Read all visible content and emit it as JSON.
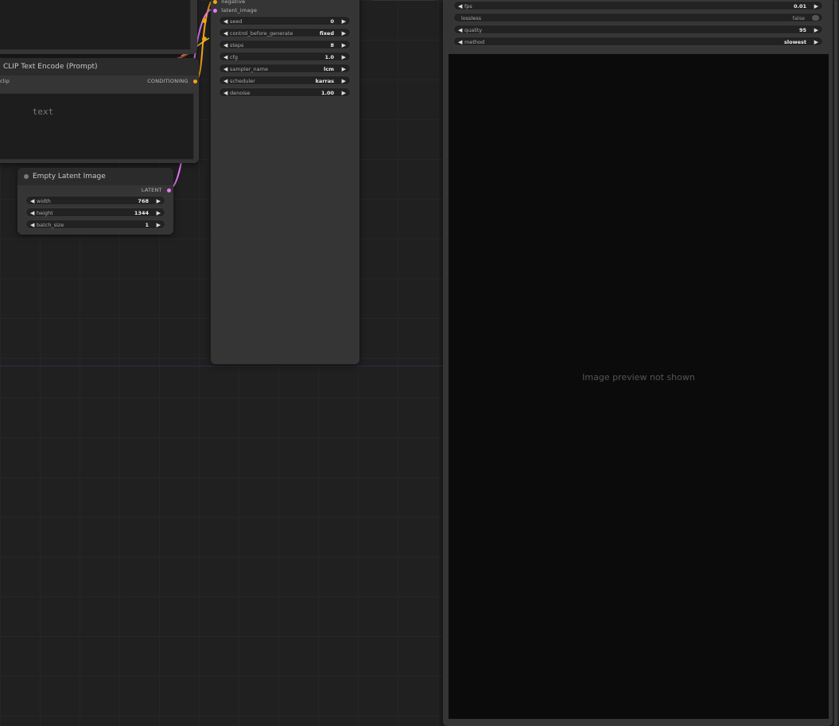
{
  "positive_prompt": {
    "text": ""
  },
  "negative_prompt_node": {
    "title": "CLIP Text Encode (Prompt)",
    "input_clip": "clip",
    "output": "CONDITIONING",
    "placeholder": "text"
  },
  "ksampler": {
    "inputs": [
      "negative",
      "latent_image"
    ],
    "widgets": [
      {
        "label": "seed",
        "value": "0"
      },
      {
        "label": "control_before_generate",
        "value": "fixed"
      },
      {
        "label": "steps",
        "value": "8"
      },
      {
        "label": "cfg",
        "value": "1.0"
      },
      {
        "label": "sampler_name",
        "value": "lcm"
      },
      {
        "label": "scheduler",
        "value": "karras"
      },
      {
        "label": "denoise",
        "value": "1.00"
      }
    ]
  },
  "empty_latent": {
    "title": "Empty Latent Image",
    "output": "LATENT",
    "widgets": [
      {
        "label": "width",
        "value": "768"
      },
      {
        "label": "height",
        "value": "1344"
      },
      {
        "label": "batch_size",
        "value": "1"
      }
    ]
  },
  "save_node": {
    "widgets": [
      {
        "label": "fps",
        "value": "0.01"
      },
      {
        "label": "lossless",
        "value": "false"
      },
      {
        "label": "quality",
        "value": "95"
      },
      {
        "label": "method",
        "value": "slowest"
      }
    ],
    "preview_notice": "Image preview not shown"
  },
  "colors": {
    "latent_wire": "#e879f9",
    "conditioning_wire": "#f4a41a",
    "clip_wire": "#f4d03f",
    "accent_red": "#e25b5b"
  }
}
